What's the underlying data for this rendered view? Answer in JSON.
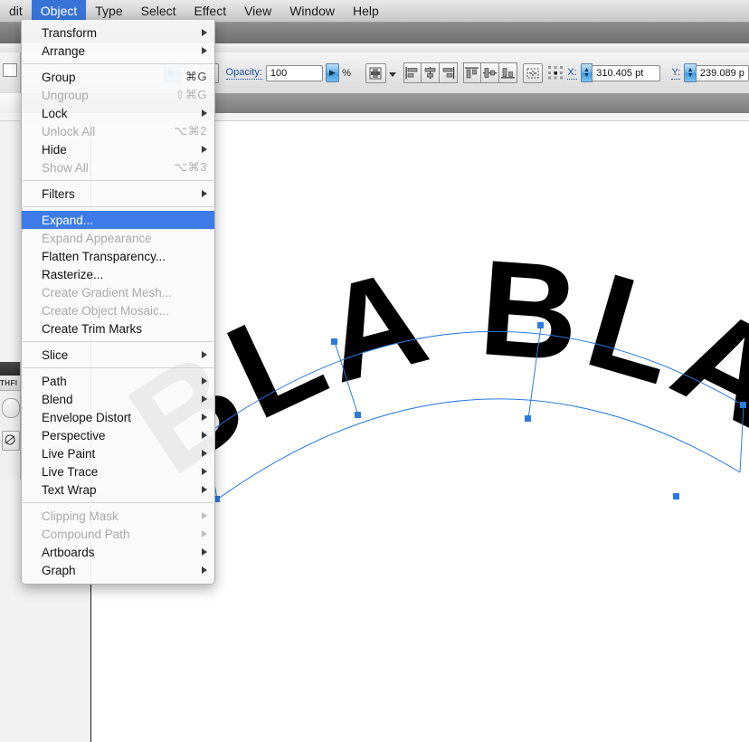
{
  "app": {
    "menubar": [
      {
        "label": "dit",
        "active": false
      },
      {
        "label": "Object",
        "active": true
      },
      {
        "label": "Type",
        "active": false
      },
      {
        "label": "Select",
        "active": false
      },
      {
        "label": "Effect",
        "active": false
      },
      {
        "label": "View",
        "active": false
      },
      {
        "label": "Window",
        "active": false
      },
      {
        "label": "Help",
        "active": false
      }
    ],
    "accent_blue": "#3d7ce8",
    "menubar_active_blue": "#3874d8"
  },
  "optionbar": {
    "percent_symbol_1": "%",
    "opacity_label": "Opacity:",
    "opacity_value": "100",
    "percent_symbol_2": "%",
    "x_label": "X:",
    "x_value": "310.405 pt",
    "y_label": "Y:",
    "y_value": "239.089 p"
  },
  "left_panel": {
    "title_fragment": "THFI"
  },
  "menu": {
    "title": "Object",
    "groups": [
      {
        "items": [
          {
            "label": "Transform",
            "shortcut": "",
            "submenu": true,
            "disabled": false,
            "selected": false
          },
          {
            "label": "Arrange",
            "shortcut": "",
            "submenu": true,
            "disabled": false,
            "selected": false
          }
        ]
      },
      {
        "items": [
          {
            "label": "Group",
            "shortcut": "⌘G",
            "submenu": false,
            "disabled": false,
            "selected": false
          },
          {
            "label": "Ungroup",
            "shortcut": "⇧⌘G",
            "submenu": false,
            "disabled": true,
            "selected": false
          },
          {
            "label": "Lock",
            "shortcut": "",
            "submenu": true,
            "disabled": false,
            "selected": false
          },
          {
            "label": "Unlock All",
            "shortcut": "⌥⌘2",
            "submenu": false,
            "disabled": true,
            "selected": false
          },
          {
            "label": "Hide",
            "shortcut": "",
            "submenu": true,
            "disabled": false,
            "selected": false
          },
          {
            "label": "Show All",
            "shortcut": "⌥⌘3",
            "submenu": false,
            "disabled": true,
            "selected": false
          }
        ]
      },
      {
        "items": [
          {
            "label": "Filters",
            "shortcut": "",
            "submenu": true,
            "disabled": false,
            "selected": false
          }
        ]
      },
      {
        "items": [
          {
            "label": "Expand...",
            "shortcut": "",
            "submenu": false,
            "disabled": false,
            "selected": true
          },
          {
            "label": "Expand Appearance",
            "shortcut": "",
            "submenu": false,
            "disabled": true,
            "selected": false
          },
          {
            "label": "Flatten Transparency...",
            "shortcut": "",
            "submenu": false,
            "disabled": false,
            "selected": false
          },
          {
            "label": "Rasterize...",
            "shortcut": "",
            "submenu": false,
            "disabled": false,
            "selected": false
          },
          {
            "label": "Create Gradient Mesh...",
            "shortcut": "",
            "submenu": false,
            "disabled": true,
            "selected": false
          },
          {
            "label": "Create Object Mosaic...",
            "shortcut": "",
            "submenu": false,
            "disabled": true,
            "selected": false
          },
          {
            "label": "Create Trim Marks",
            "shortcut": "",
            "submenu": false,
            "disabled": false,
            "selected": false
          }
        ]
      },
      {
        "items": [
          {
            "label": "Slice",
            "shortcut": "",
            "submenu": true,
            "disabled": false,
            "selected": false
          }
        ]
      },
      {
        "items": [
          {
            "label": "Path",
            "shortcut": "",
            "submenu": true,
            "disabled": false,
            "selected": false
          },
          {
            "label": "Blend",
            "shortcut": "",
            "submenu": true,
            "disabled": false,
            "selected": false
          },
          {
            "label": "Envelope Distort",
            "shortcut": "",
            "submenu": true,
            "disabled": false,
            "selected": false
          },
          {
            "label": "Perspective",
            "shortcut": "",
            "submenu": true,
            "disabled": false,
            "selected": false
          },
          {
            "label": "Live Paint",
            "shortcut": "",
            "submenu": true,
            "disabled": false,
            "selected": false
          },
          {
            "label": "Live Trace",
            "shortcut": "",
            "submenu": true,
            "disabled": false,
            "selected": false
          },
          {
            "label": "Text Wrap",
            "shortcut": "",
            "submenu": true,
            "disabled": false,
            "selected": false
          }
        ]
      },
      {
        "items": [
          {
            "label": "Clipping Mask",
            "shortcut": "",
            "submenu": true,
            "disabled": true,
            "selected": false
          },
          {
            "label": "Compound Path",
            "shortcut": "",
            "submenu": true,
            "disabled": true,
            "selected": false
          },
          {
            "label": "Artboards",
            "shortcut": "",
            "submenu": true,
            "disabled": false,
            "selected": false
          },
          {
            "label": "Graph",
            "shortcut": "",
            "submenu": true,
            "disabled": false,
            "selected": false
          }
        ]
      }
    ]
  },
  "artwork": {
    "text": "BLA BLA",
    "path_color": "#2b7ae0",
    "fill_color": "#000000"
  }
}
